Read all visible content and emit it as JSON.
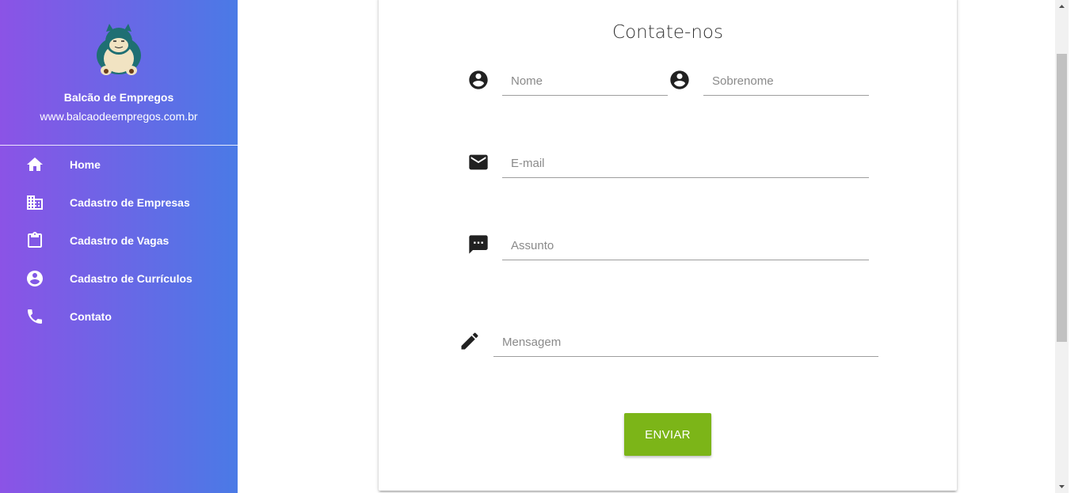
{
  "sidebar": {
    "brand_name": "Balcão de Empregos",
    "brand_url": "www.balcaodeempregos.com.br",
    "items": [
      {
        "label": "Home",
        "icon": "home-icon"
      },
      {
        "label": "Cadastro de Empresas",
        "icon": "building-icon"
      },
      {
        "label": "Cadastro de Vagas",
        "icon": "clipboard-icon"
      },
      {
        "label": "Cadastro de Currículos",
        "icon": "account-circle-icon"
      },
      {
        "label": "Contato",
        "icon": "phone-icon"
      }
    ]
  },
  "form": {
    "title": "Contate-nos",
    "first_name_placeholder": "Nome",
    "last_name_placeholder": "Sobrenome",
    "email_placeholder": "E-mail",
    "subject_placeholder": "Assunto",
    "message_placeholder": "Mensagem",
    "submit_label": "ENVIAR"
  },
  "colors": {
    "sidebar_gradient_start": "#8b53e6",
    "sidebar_gradient_end": "#4a7ae6",
    "submit_button": "#7cb518"
  }
}
